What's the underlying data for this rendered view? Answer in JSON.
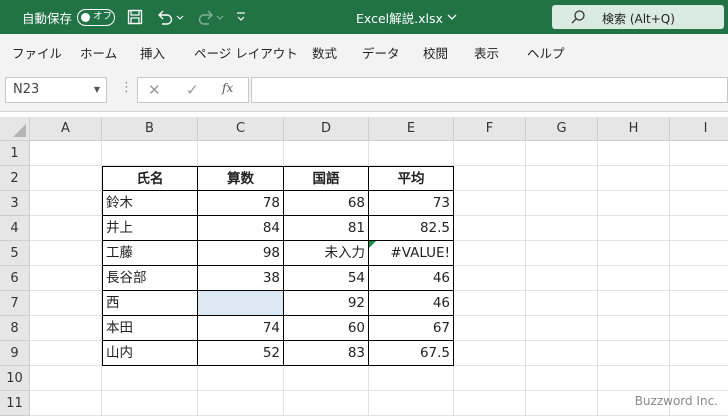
{
  "titlebar": {
    "autosave_label": "自動保存",
    "autosave_state": "オフ",
    "document_title": "Excel解説.xlsx",
    "search_placeholder": "検索 (Alt+Q)"
  },
  "menu": {
    "tabs": [
      "ファイル",
      "ホーム",
      "挿入",
      "ページ レイアウト",
      "数式",
      "データ",
      "校閲",
      "表示",
      "ヘルプ"
    ]
  },
  "formula_bar": {
    "name_box": "N23",
    "fx_label": "fx",
    "value": ""
  },
  "grid": {
    "columns": [
      "A",
      "B",
      "C",
      "D",
      "E",
      "F",
      "G",
      "H",
      "I"
    ],
    "active_column": "N",
    "rows": [
      "1",
      "2",
      "3",
      "4",
      "5",
      "6",
      "7",
      "8",
      "9",
      "10",
      "11"
    ]
  },
  "table": {
    "headers": [
      "氏名",
      "算数",
      "国語",
      "平均"
    ],
    "rows": [
      [
        "鈴木",
        "78",
        "68",
        "73"
      ],
      [
        "井上",
        "84",
        "81",
        "82.5"
      ],
      [
        "工藤",
        "98",
        "未入力",
        "#VALUE!"
      ],
      [
        "長谷部",
        "38",
        "54",
        "46"
      ],
      [
        "西",
        "",
        "92",
        "46"
      ],
      [
        "本田",
        "74",
        "60",
        "67"
      ],
      [
        "山内",
        "52",
        "83",
        "67.5"
      ]
    ]
  },
  "colors": {
    "excel_green": "#217346",
    "selected_cell": "#dde8f5"
  },
  "watermark": "Buzzword Inc."
}
